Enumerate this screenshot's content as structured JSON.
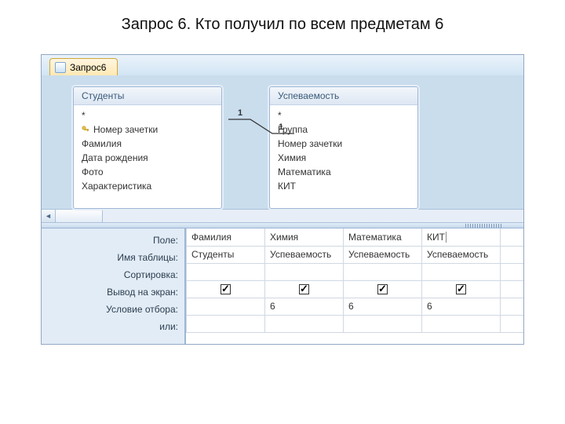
{
  "page_title": "Запрос 6. Кто получил по всем предметам 6",
  "tab": {
    "label": "Запрос6"
  },
  "tables": {
    "students": {
      "title": "Студенты",
      "star": "*",
      "fields": [
        "Номер зачетки",
        "Фамилия",
        "Дата рождения",
        "Фото",
        "Характеристика"
      ],
      "key_field_index": 0
    },
    "grades": {
      "title": "Успеваемость",
      "star": "*",
      "fields": [
        "Группа",
        "Номер зачетки",
        "Химия",
        "Математика",
        "КИТ"
      ]
    }
  },
  "relationship": {
    "left": "1",
    "right": "1"
  },
  "grid": {
    "row_labels": [
      "Поле:",
      "Имя таблицы:",
      "Сортировка:",
      "Вывод на экран:",
      "Условие отбора:",
      "или:"
    ],
    "columns": [
      {
        "field": "Фамилия",
        "table": "Студенты",
        "sort": "",
        "show": true,
        "criteria": "",
        "or": ""
      },
      {
        "field": "Химия",
        "table": "Успеваемость",
        "sort": "",
        "show": true,
        "criteria": "6",
        "or": ""
      },
      {
        "field": "Математика",
        "table": "Успеваемость",
        "sort": "",
        "show": true,
        "criteria": "6",
        "or": ""
      },
      {
        "field": "КИТ",
        "table": "Успеваемость",
        "sort": "",
        "show": true,
        "criteria": "6",
        "or": ""
      }
    ]
  }
}
